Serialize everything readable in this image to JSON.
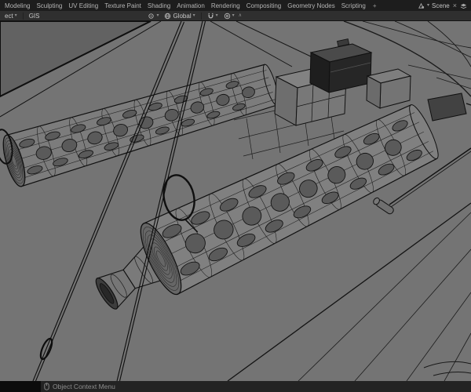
{
  "topbar": {
    "tabs": [
      "Modeling",
      "Sculpting",
      "UV Editing",
      "Texture Paint",
      "Shading",
      "Animation",
      "Rendering",
      "Compositing",
      "Geometry Nodes",
      "Scripting"
    ],
    "add_workspace": "+",
    "scene_selector": {
      "label": "Scene",
      "clear": "×"
    }
  },
  "viewport_header": {
    "mode_fragment": "ect",
    "menu_gis": "GIS",
    "orientation_label": "Global"
  },
  "status_bar": {
    "hint": "Object Context Menu"
  },
  "icons": {
    "caret_down": "▾",
    "collapse": "∧"
  },
  "colors": {
    "topbar_bg": "#1d1d1d",
    "viewport_header_bg": "#2f2f2f",
    "viewport_bg": "#747474",
    "statusbar_bg": "#232323",
    "wireframe": "#101010",
    "surface": "#808080",
    "dark_box": "#262626"
  }
}
